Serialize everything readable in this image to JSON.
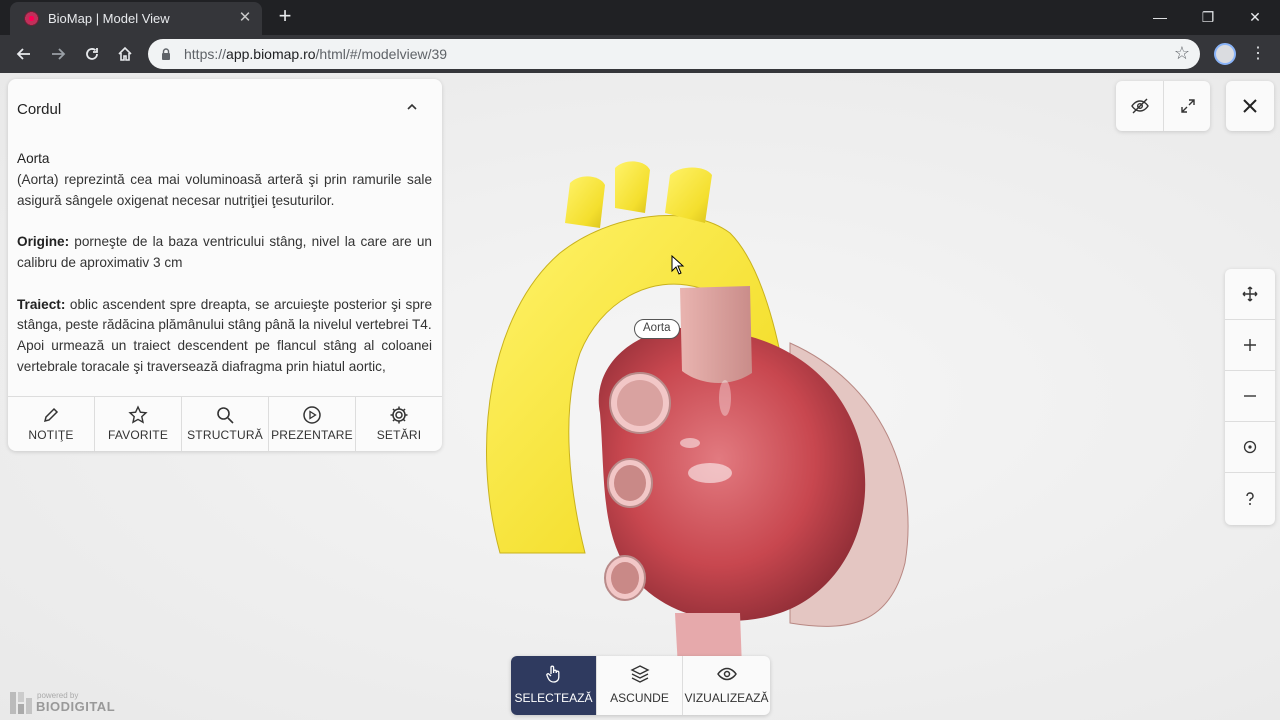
{
  "browser": {
    "tab_title": "BioMap | Model View",
    "url_prefix": "https://",
    "url_host": "app.biomap.ro",
    "url_path": "/html/#/modelview/39"
  },
  "panel": {
    "title": "Cordul",
    "item_name": "Aorta",
    "description": "(Aorta) reprezintă cea mai voluminoasă arteră şi prin ramurile sale asigură sângele oxigenat necesar nutriţiei ţesuturilor.",
    "origin_label": "Origine:",
    "origin_text": " porneşte de la baza ventricului stâng, nivel la care are un calibru de aproximativ 3 cm",
    "path_label": "Traiect:",
    "path_text": " oblic ascendent spre dreapta, se arcuieşte posterior şi spre stânga, peste rădăcina plămânului stâng până la nivelul vertebrei T4.",
    "path_text_2": "Apoi urmează un traiect descendent pe flancul stâng al coloanei vertebrale toracale şi traversează diafragma prin hiatul aortic,",
    "nav": [
      {
        "label": "NOTIŢE",
        "icon": "pencil-icon"
      },
      {
        "label": "FAVORITE",
        "icon": "star-icon"
      },
      {
        "label": "STRUCTURĂ",
        "icon": "search-icon"
      },
      {
        "label": "PREZENTARE",
        "icon": "play-icon"
      },
      {
        "label": "SETĂRI",
        "icon": "gear-icon"
      }
    ]
  },
  "model": {
    "label": "Aorta"
  },
  "bottom_bar": [
    {
      "label": "SELECTEAZĂ",
      "icon": "hand-pointer-icon",
      "active": true
    },
    {
      "label": "ASCUNDE",
      "icon": "layers-icon",
      "active": false
    },
    {
      "label": "VIZUALIZEAZĂ",
      "icon": "eye-icon",
      "active": false
    }
  ],
  "powered_by": {
    "small": "powered by",
    "big": "BIODIGITAL"
  },
  "colors": {
    "accent": "#2f3a5f",
    "aorta": "#f5e43a",
    "heart": "#c94a55"
  }
}
